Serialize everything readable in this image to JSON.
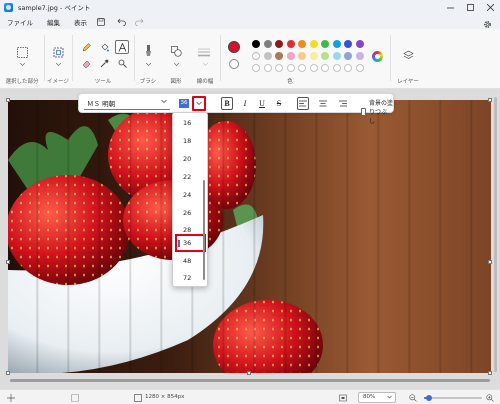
{
  "window": {
    "title": "sample7.jpg - ペイント",
    "controls": [
      "minimize-icon",
      "maximize-icon",
      "close-icon"
    ]
  },
  "menu": {
    "items": [
      "ファイル",
      "編集",
      "表示"
    ],
    "icons": [
      "save-icon",
      "undo-icon",
      "redo-icon",
      "gear-icon"
    ]
  },
  "ribbon": {
    "groups": [
      {
        "label": "選択した部分"
      },
      {
        "label": "イメージ"
      },
      {
        "label": "ツール"
      },
      {
        "label": "ブラシ"
      },
      {
        "label": "図形"
      },
      {
        "label": "線の幅"
      },
      {
        "label": "色"
      },
      {
        "label": "レイヤー"
      }
    ],
    "colors": {
      "primary": "#d8112b",
      "swatches_row1": [
        "#000000",
        "#7f7f7f",
        "#8b1a1a",
        "#e02d2d",
        "#f08a1b",
        "#f6dc20",
        "#3dbb4a",
        "#15a0e6",
        "#3b4fd6",
        "#8a43c8"
      ],
      "swatches_row2": [
        "#ffffff",
        "#c3c3c3",
        "#a57a5a",
        "#f4a3c0",
        "#f7c98b",
        "#f6ef9c",
        "#b6e08f",
        "#9ad6ef",
        "#8ea4d6",
        "#c7b2e0"
      ]
    }
  },
  "text_toolbar": {
    "font_name": "ＭＳ 明朝",
    "font_size": "36",
    "bold": "B",
    "italic": "I",
    "underline": "U",
    "strikethrough": "S",
    "background_fill_label": "背景の塗りつぶし"
  },
  "font_size_list": {
    "items": [
      "16",
      "18",
      "20",
      "22",
      "24",
      "26",
      "28",
      "36",
      "48",
      "72"
    ],
    "selected": "36"
  },
  "status": {
    "image_size": "1280 × 854px",
    "zoom": "80%",
    "zoom_level": 0.08
  }
}
